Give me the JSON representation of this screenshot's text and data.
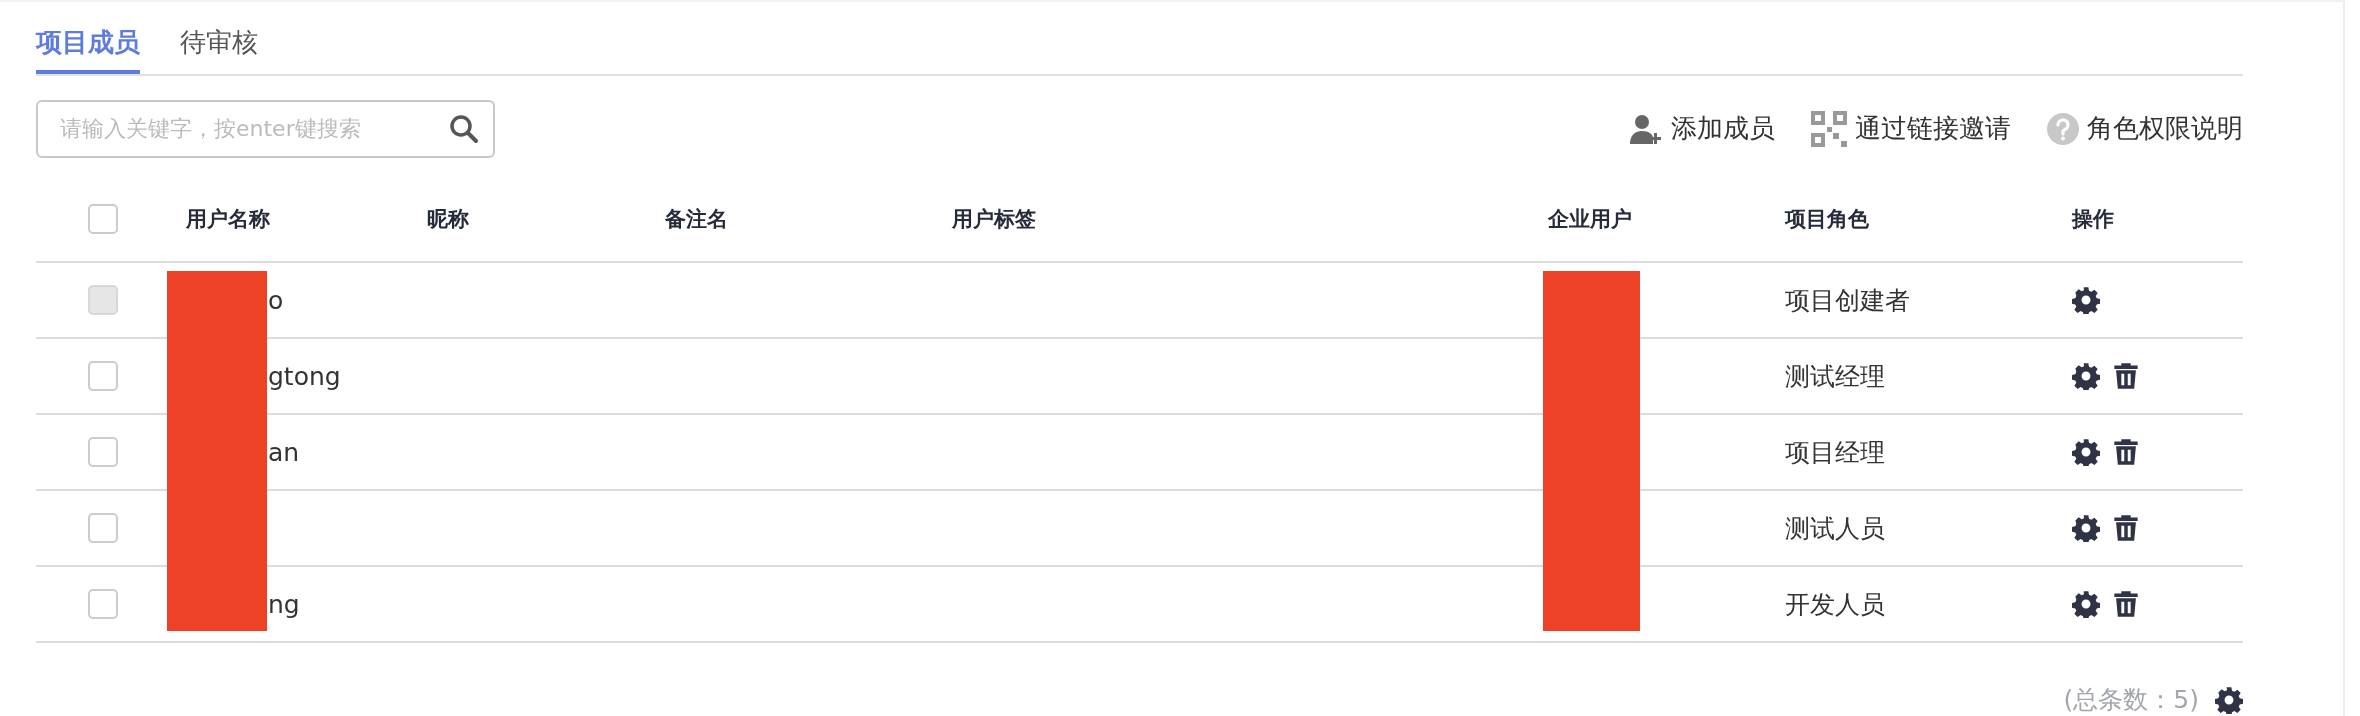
{
  "tabs": [
    {
      "label": "项目成员",
      "selected": true
    },
    {
      "label": "待审核",
      "selected": false
    }
  ],
  "search": {
    "placeholder": "请输入关键字，按enter键搜索"
  },
  "actions": [
    {
      "kind": "add-member",
      "label": "添加成员"
    },
    {
      "kind": "qr-invite",
      "label": "通过链接邀请"
    },
    {
      "kind": "help",
      "label": "角色权限说明"
    }
  ],
  "table": {
    "select_all": {
      "checked": false
    },
    "columns": [
      "用户名称",
      "昵称",
      "备注名",
      "用户标签",
      "企业用户",
      "项目角色",
      "操作"
    ],
    "rows": [
      {
        "checked": false,
        "disabled": true,
        "user_name": "o",
        "role": "项目创建者",
        "deletable": false
      },
      {
        "checked": false,
        "disabled": false,
        "user_name": "gtong",
        "role": "测试经理",
        "deletable": true
      },
      {
        "checked": false,
        "disabled": false,
        "user_name": "an",
        "role": "项目经理",
        "deletable": true
      },
      {
        "checked": false,
        "disabled": false,
        "role": "测试人员",
        "deletable": true
      },
      {
        "checked": false,
        "disabled": false,
        "user_name": "ng",
        "role": "开发人员",
        "deletable": true
      }
    ]
  },
  "footer": {
    "total": "(总条数：5)"
  }
}
